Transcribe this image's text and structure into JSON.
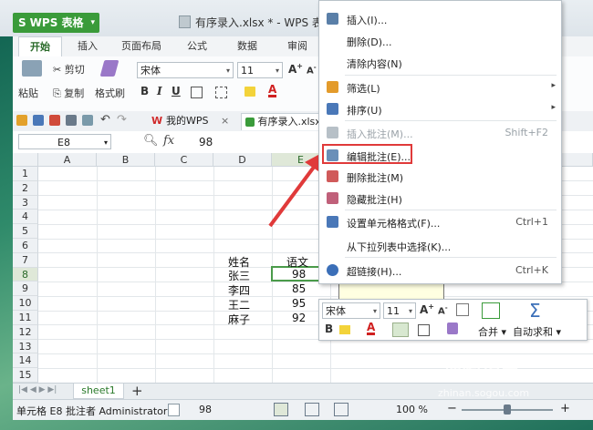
{
  "app": {
    "name": "WPS 表格",
    "window_title": "有序录入.xlsx * - WPS 表格"
  },
  "tabs": [
    "开始",
    "插入",
    "页面布局",
    "公式",
    "数据",
    "审阅"
  ],
  "ribbon": {
    "paste": "粘贴",
    "cut": "剪切",
    "copy": "复制",
    "format_painter": "格式刷",
    "font_name": "宋体",
    "font_size": "11"
  },
  "doc_tabs": {
    "mywps": "我的WPS",
    "file": "有序录入.xlsx"
  },
  "formula_bar": {
    "cell_ref": "E8",
    "fx": "fx",
    "value": "98"
  },
  "grid": {
    "columns": [
      "A",
      "B",
      "C",
      "D",
      "E"
    ],
    "rows": [
      "1",
      "2",
      "3",
      "4",
      "5",
      "6",
      "7",
      "8",
      "9",
      "10",
      "11",
      "12",
      "13",
      "14",
      "15"
    ],
    "headers": {
      "name": "姓名",
      "subject": "语文"
    },
    "data": [
      {
        "name": "张三",
        "score": "98"
      },
      {
        "name": "李四",
        "score": "85"
      },
      {
        "name": "王二",
        "score": "95"
      },
      {
        "name": "麻子",
        "score": "92"
      }
    ]
  },
  "sheets": [
    "sheet1"
  ],
  "status": {
    "left": "单元格 E8 批注者 Administrator",
    "value": "98",
    "zoom": "100 %"
  },
  "context_menu": [
    {
      "label": "插入(I)...",
      "shortcut": "",
      "submenu": false,
      "disabled": false,
      "icon": "insert-icon",
      "color": "#5a7fa8"
    },
    {
      "label": "删除(D)...",
      "shortcut": "",
      "submenu": false,
      "disabled": false,
      "icon": "",
      "color": ""
    },
    {
      "label": "清除内容(N)",
      "shortcut": "",
      "submenu": false,
      "disabled": false,
      "icon": "",
      "color": ""
    },
    {
      "label": "筛选(L)",
      "shortcut": "",
      "submenu": true,
      "disabled": false,
      "icon": "filter-icon",
      "color": "#e39b2b"
    },
    {
      "label": "排序(U)",
      "shortcut": "",
      "submenu": true,
      "disabled": false,
      "icon": "sort-icon",
      "color": "#4a78b8"
    },
    {
      "label": "插入批注(M)...",
      "shortcut": "Shift+F2",
      "submenu": false,
      "disabled": true,
      "icon": "insert-comment-icon",
      "color": "#b7c0c7"
    },
    {
      "label": "编辑批注(E)...",
      "shortcut": "",
      "submenu": false,
      "disabled": false,
      "icon": "edit-comment-icon",
      "color": "#6a8fb8"
    },
    {
      "label": "删除批注(M)",
      "shortcut": "",
      "submenu": false,
      "disabled": false,
      "icon": "delete-comment-icon",
      "color": "#d05a5a"
    },
    {
      "label": "隐藏批注(H)",
      "shortcut": "",
      "submenu": false,
      "disabled": false,
      "icon": "hide-comment-icon",
      "color": "#c0607a"
    },
    {
      "label": "设置单元格格式(F)...",
      "shortcut": "Ctrl+1",
      "submenu": false,
      "disabled": false,
      "icon": "format-cells-icon",
      "color": "#4a78b8"
    },
    {
      "label": "从下拉列表中选择(K)...",
      "shortcut": "",
      "submenu": false,
      "disabled": false,
      "icon": "",
      "color": ""
    },
    {
      "label": "超链接(H)...",
      "shortcut": "Ctrl+K",
      "submenu": false,
      "disabled": false,
      "icon": "hyperlink-icon",
      "color": "#3b6fb8"
    }
  ],
  "mini_toolbar": {
    "font_name": "宋体",
    "font_size": "11",
    "merge": "合并",
    "autosum": "自动求和"
  },
  "watermark": {
    "brand": "搜狗指南",
    "url": "zhinan.sogou.com"
  },
  "colors": {
    "accent_green": "#3a9b3a",
    "highlight_red": "#e03a3a",
    "selection_green": "#4a9b4a"
  }
}
